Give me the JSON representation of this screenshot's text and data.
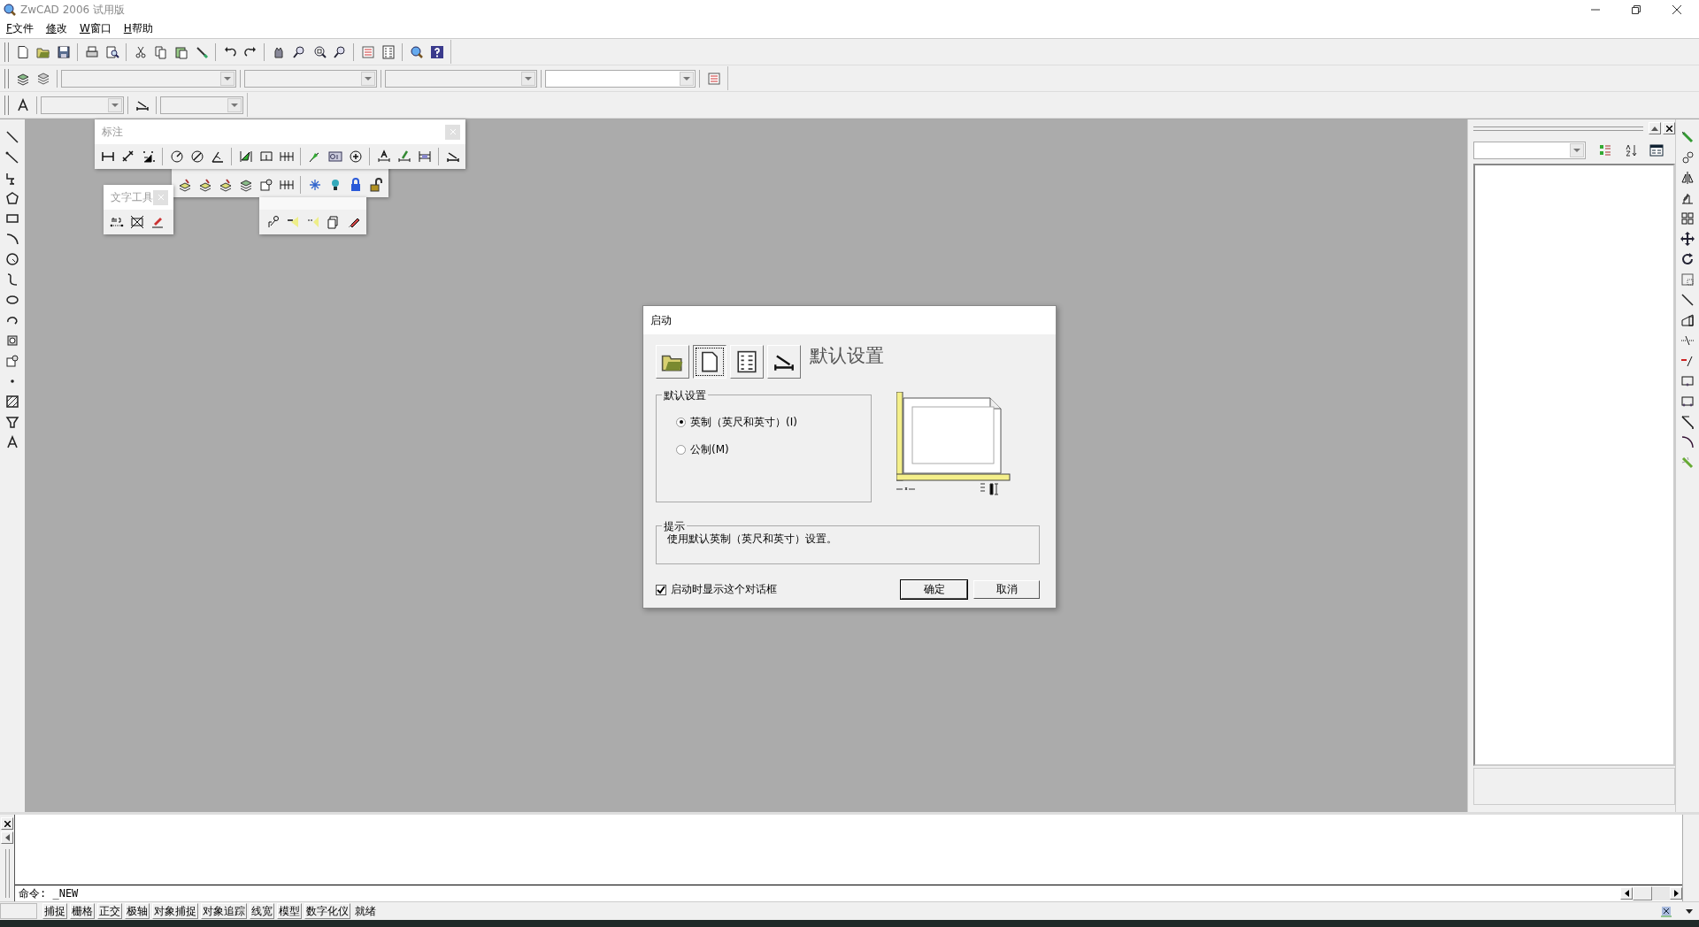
{
  "window": {
    "title": "ZwCAD 2006 试用版"
  },
  "menu": [
    {
      "label": "F文件"
    },
    {
      "label": "修改"
    },
    {
      "label": "W窗口"
    },
    {
      "label": "H帮助"
    }
  ],
  "layer_bar": {
    "dropdowns": [
      {
        "disabled": true
      },
      {
        "disabled": true
      },
      {
        "disabled": true
      },
      {
        "disabled": false
      }
    ]
  },
  "style_bar": {
    "dropdowns": [
      {
        "disabled": true
      },
      {
        "disabled": true
      }
    ]
  },
  "floating_toolbars": [
    {
      "title": "标注"
    },
    {
      "title": "文字工具"
    }
  ],
  "dialog": {
    "title": "启动",
    "heading": "默认设置",
    "tabs": [
      {
        "selected": false
      },
      {
        "selected": true
      },
      {
        "selected": false
      },
      {
        "selected": false
      }
    ],
    "group_title": "默认设置",
    "options": [
      {
        "label": "英制（英尺和英寸）(I)",
        "selected": true
      },
      {
        "label": "公制(M)",
        "selected": false
      }
    ],
    "hint_title": "提示",
    "hint": "使用默认英制（英尺和英寸）设置。",
    "show_on_startup": {
      "label": "启动时显示这个对话框",
      "checked": true
    },
    "buttons": [
      "确定",
      "取消"
    ]
  },
  "command_line": {
    "prompt": "命令: _NEW"
  },
  "status_bar": {
    "toggles": [
      {
        "label": "捕捉"
      },
      {
        "label": "栅格"
      },
      {
        "label": "正交"
      },
      {
        "label": "极轴"
      },
      {
        "label": "对象捕捉"
      },
      {
        "label": "对象追踪"
      },
      {
        "label": "线宽"
      },
      {
        "label": "模型"
      },
      {
        "label": "数字化仪"
      }
    ],
    "status": "就绪"
  }
}
